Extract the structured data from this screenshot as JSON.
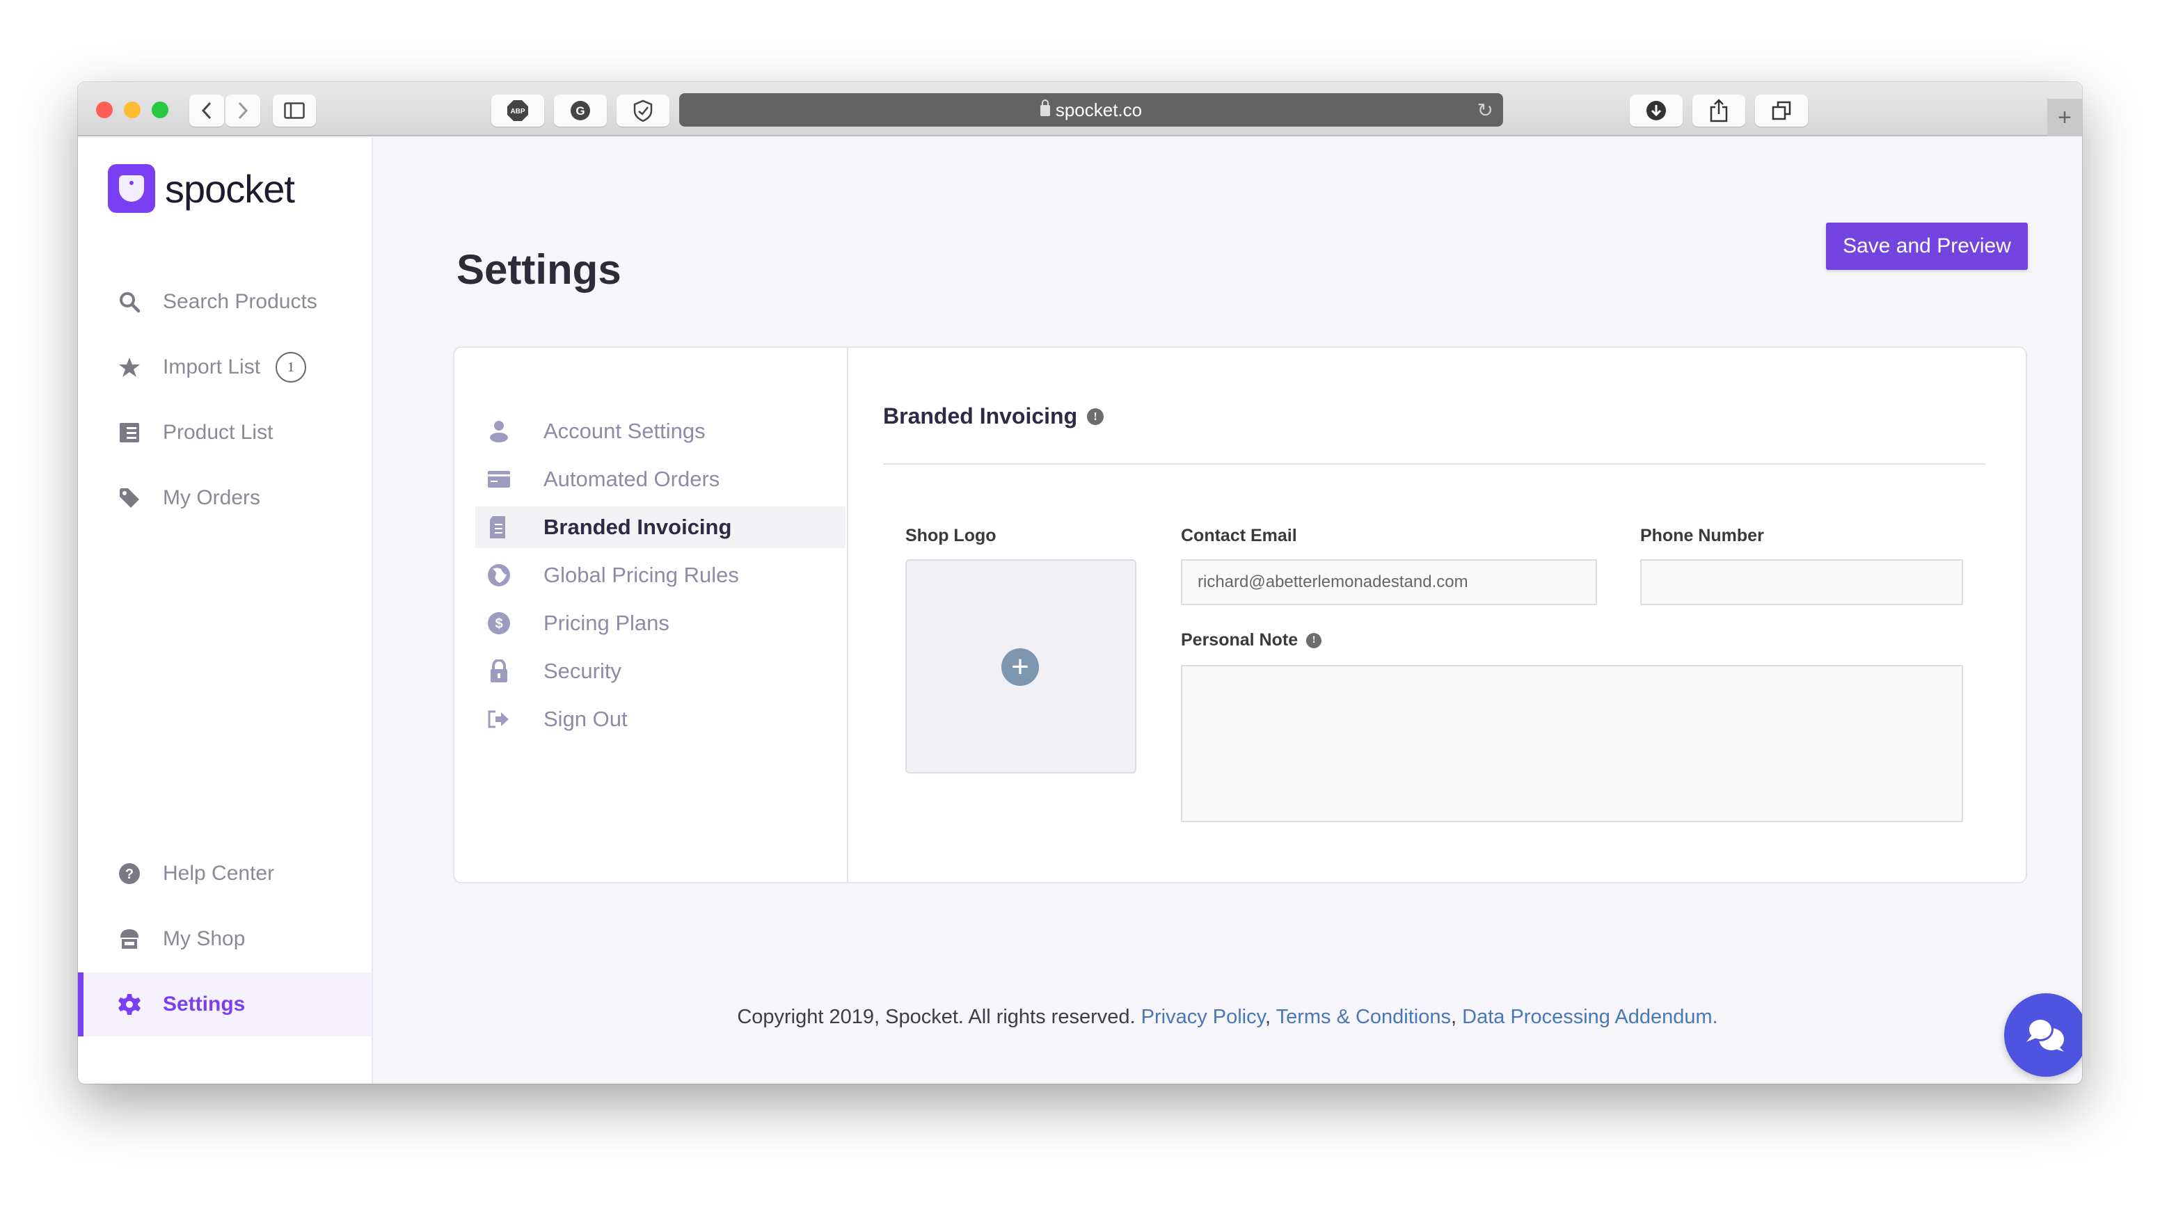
{
  "browser": {
    "url": "spocket.co",
    "extensions": [
      {
        "name": "abp-icon",
        "label": "ABP"
      },
      {
        "name": "grammarly-icon",
        "label": "G"
      },
      {
        "name": "shield-extension-icon",
        "label": "⛉"
      }
    ]
  },
  "sidebar": {
    "brand": "spocket",
    "items": [
      {
        "label": "Search Products",
        "icon": "search-icon"
      },
      {
        "label": "Import List",
        "icon": "star-icon",
        "badge": "1"
      },
      {
        "label": "Product List",
        "icon": "list-icon"
      },
      {
        "label": "My Orders",
        "icon": "tag-icon"
      }
    ],
    "bottom_items": [
      {
        "label": "Help Center",
        "icon": "help-icon"
      },
      {
        "label": "My Shop",
        "icon": "shop-icon"
      },
      {
        "label": "Settings",
        "icon": "gear-icon",
        "active": true
      }
    ]
  },
  "page": {
    "title": "Settings",
    "save_button": "Save and Preview"
  },
  "settings_nav": [
    {
      "label": "Account Settings",
      "icon": "user-icon"
    },
    {
      "label": "Automated Orders",
      "icon": "credit-card-icon"
    },
    {
      "label": "Branded Invoicing",
      "icon": "document-icon",
      "active": true
    },
    {
      "label": "Global Pricing Rules",
      "icon": "globe-icon"
    },
    {
      "label": "Pricing Plans",
      "icon": "dollar-icon"
    },
    {
      "label": "Security",
      "icon": "lock-icon"
    },
    {
      "label": "Sign Out",
      "icon": "sign-out-icon"
    }
  ],
  "panel": {
    "title": "Branded Invoicing",
    "shop_logo_label": "Shop Logo",
    "contact_email_label": "Contact Email",
    "contact_email_value": "richard@abetterlemonadestand.com",
    "phone_label": "Phone Number",
    "phone_value": "",
    "personal_note_label": "Personal Note",
    "personal_note_value": ""
  },
  "footer": {
    "copyright": "Copyright 2019, Spocket. All rights reserved. ",
    "links": [
      "Privacy Policy",
      "Terms & Conditions",
      "Data Processing Addendum"
    ]
  },
  "colors": {
    "brand": "#7a3ff2",
    "button": "#7444e0",
    "link": "#4a78b6",
    "chat": "#4f54e0"
  }
}
